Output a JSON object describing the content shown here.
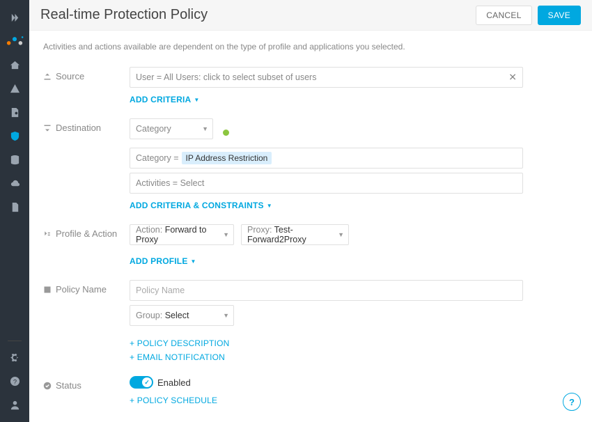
{
  "header": {
    "title": "Real-time Protection Policy",
    "cancel": "CANCEL",
    "save": "SAVE"
  },
  "nav_icons": [
    "chevrons",
    "logo",
    "home",
    "warning",
    "doc-search",
    "shield",
    "database",
    "cloud",
    "file",
    "antenna"
  ],
  "nav_bottom_icons": [
    "gear",
    "help",
    "user"
  ],
  "note": "Activities and actions available are dependent on the type of profile and applications you selected.",
  "sections": {
    "source": {
      "label": "Source",
      "value": "User = All Users: click to select subset of users",
      "link": "ADD CRITERIA"
    },
    "destination": {
      "label": "Destination",
      "category_selector": "Category",
      "category_field_prefix": "Category = ",
      "category_tag": "IP Address Restriction",
      "activities_prefix": "Activities = ",
      "activities_value": "Select",
      "link": "ADD CRITERIA & CONSTRAINTS"
    },
    "profile_action": {
      "label": "Profile & Action",
      "action_prefix": "Action: ",
      "action_value": "Forward to Proxy",
      "proxy_prefix": "Proxy: ",
      "proxy_value": "Test-Forward2Proxy",
      "link": "ADD PROFILE"
    },
    "policy_name": {
      "label": "Policy Name",
      "placeholder": "Policy Name",
      "group_prefix": "Group: ",
      "group_value": "Select",
      "link_desc": "+ POLICY DESCRIPTION",
      "link_email": "+ EMAIL NOTIFICATION"
    },
    "status": {
      "label": "Status",
      "enabled": "Enabled",
      "link_schedule": "+ POLICY SCHEDULE"
    }
  }
}
